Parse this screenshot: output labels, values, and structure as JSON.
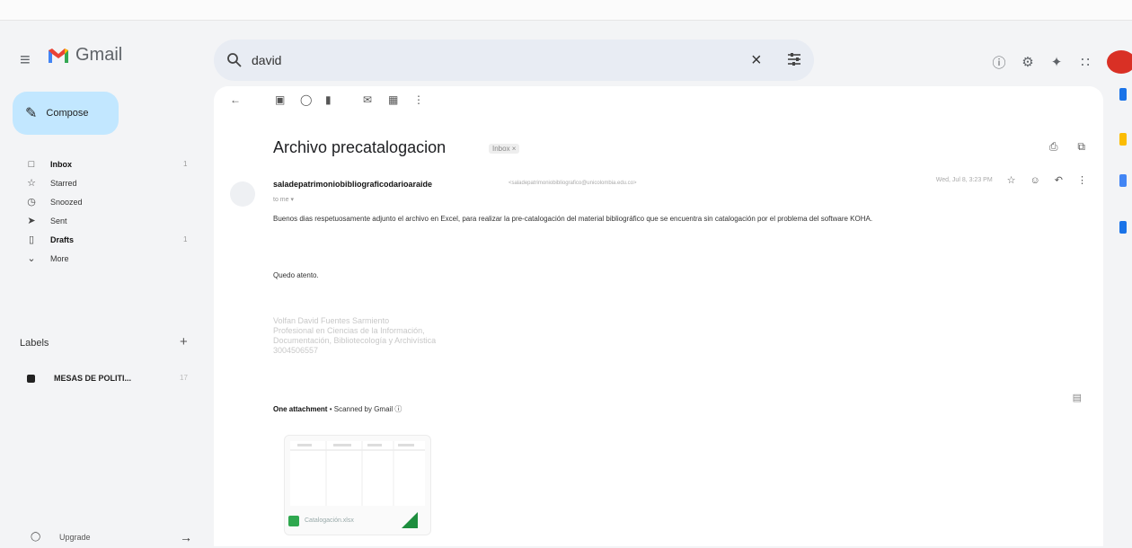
{
  "app": {
    "name": "Gmail"
  },
  "search": {
    "value": "david"
  },
  "sidebar": {
    "compose_label": "Compose",
    "items": [
      {
        "label": "Inbox",
        "icon": "inbox-icon",
        "count": "1",
        "bold": true
      },
      {
        "label": "Starred",
        "icon": "star-icon",
        "count": "",
        "bold": false
      },
      {
        "label": "Snoozed",
        "icon": "clock-icon",
        "count": "",
        "bold": false
      },
      {
        "label": "Sent",
        "icon": "send-icon",
        "count": "",
        "bold": false
      },
      {
        "label": "Drafts",
        "icon": "draft-icon",
        "count": "1",
        "bold": true
      },
      {
        "label": "More",
        "icon": "chevron-down-icon",
        "count": "",
        "bold": false
      }
    ],
    "labels_heading": "Labels",
    "labels": [
      {
        "label": "MESAS DE POLITI...",
        "count": "17"
      }
    ],
    "upgrade_label": "Upgrade"
  },
  "email": {
    "subject": "Archivo precatalogacion",
    "chip": "Inbox ×",
    "sender": "saladepatrimoniobibliograficodarioaraide",
    "sender_address": "<saladepatrimoniobibliografico@unicolombia.edu.co>",
    "to_me": "to me ▾",
    "date": "Wed, Jul 8, 3:23 PM",
    "body": "Buenos dias respetuosamente adjunto el archivo en Excel, para realizar la pre-catalogación del material bibliográfico que se encuentra sin catalogación por el problema del software KOHA.",
    "closing": "Quedo atento.",
    "signature": [
      "Volfan David Fuentes Sarmiento",
      "Profesional en Ciencias de la Información,",
      "Documentación, Bibliotecología y Archivística",
      "3004506557"
    ],
    "attachment_heading": "One attachment",
    "scanned_by": "•  Scanned by Gmail ⓘ",
    "attachment_name": "Catalogación.xlsx"
  },
  "colors": {
    "compose_bg": "#c2e7ff",
    "search_bg": "#e8ecf3",
    "avatar": "#d93025",
    "excel_green": "#2fa84f"
  }
}
